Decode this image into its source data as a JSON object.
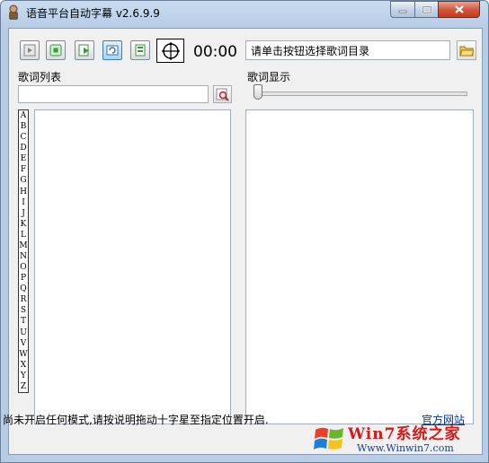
{
  "window": {
    "title": "语音平台自动字幕 v2.6.9.9"
  },
  "toolbar": {
    "timer": "00:00",
    "directory_placeholder": "请单击按钮选择歌词目录"
  },
  "lyric_list": {
    "label": "歌词列表",
    "alphabet": [
      "A",
      "B",
      "C",
      "D",
      "E",
      "F",
      "G",
      "H",
      "I",
      "J",
      "K",
      "L",
      "M",
      "N",
      "O",
      "P",
      "Q",
      "R",
      "S",
      "T",
      "U",
      "V",
      "W",
      "X",
      "Y",
      "Z"
    ]
  },
  "lyric_display": {
    "label": "歌词显示",
    "slider_value": 0
  },
  "status": {
    "text": "尚未开启任何模式,请按说明拖动十字星至指定位置开启.",
    "link": "官方网站"
  },
  "watermark": {
    "brand": "Win7系统之家",
    "url": "Www.Winwin7.com"
  },
  "colors": {
    "title_bar": "#b7cde6",
    "close_button": "#c1391c",
    "client_bg": "#f0f0f0",
    "link": "#0033aa"
  }
}
